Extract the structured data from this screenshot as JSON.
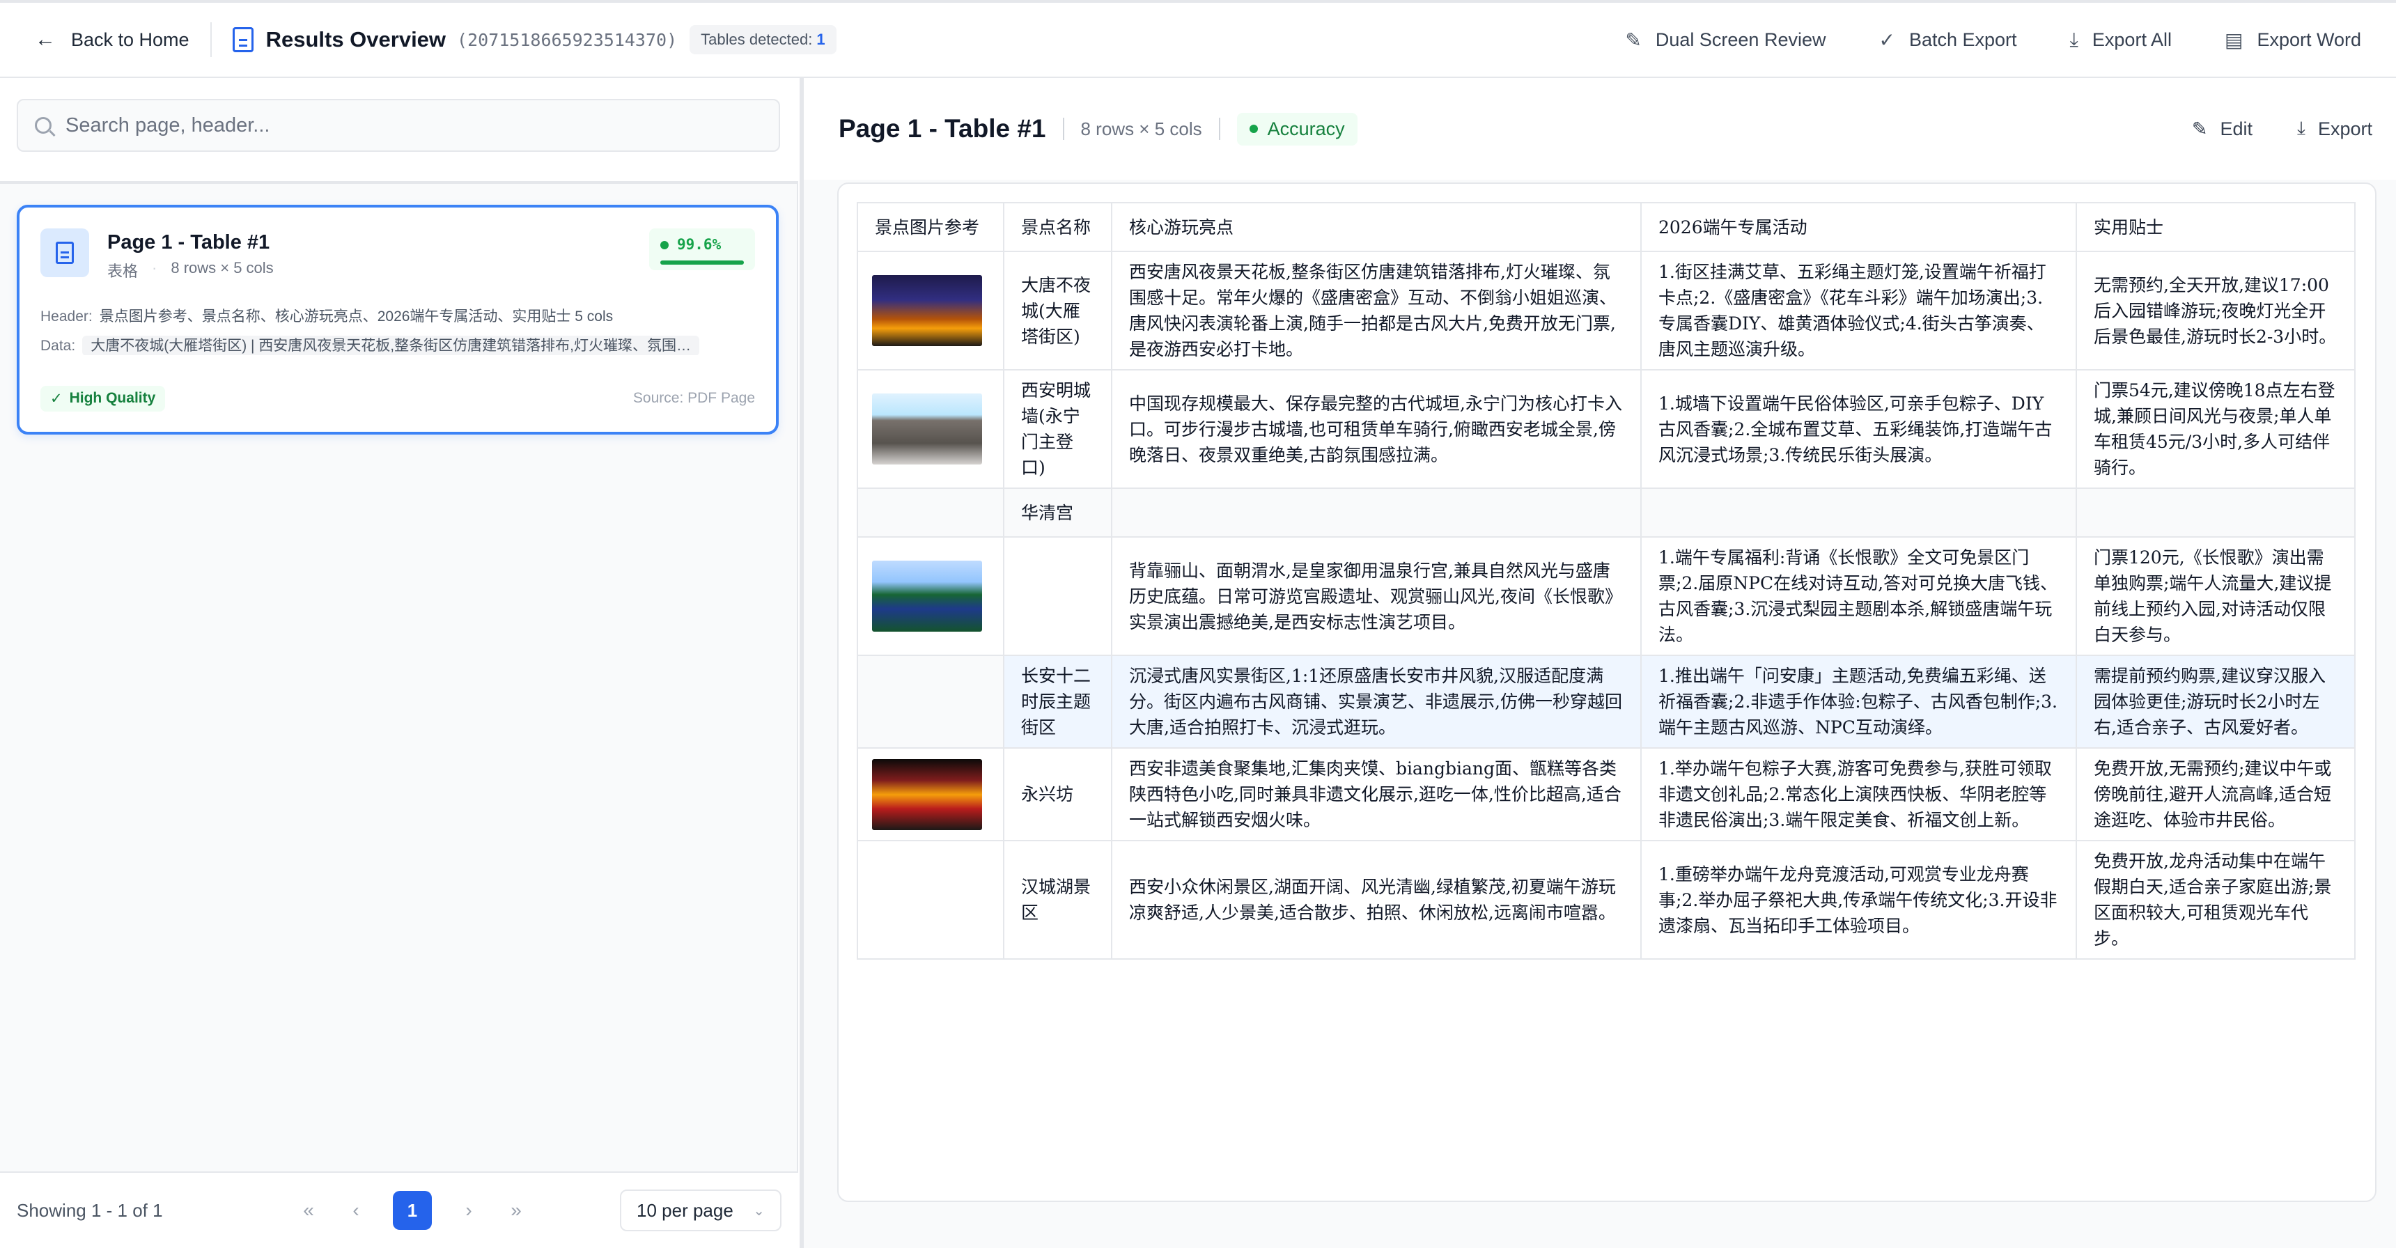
{
  "topbar": {
    "back_label": "Back to Home",
    "title": "Results Overview",
    "doc_id": "(2071518665923514370)",
    "tables_detected_label": "Tables detected:",
    "tables_detected_count": "1",
    "actions": [
      "Dual Screen Review",
      "Batch Export",
      "Export All",
      "Export Word"
    ]
  },
  "sidebar": {
    "search_placeholder": "Search page, header...",
    "card": {
      "title": "Page 1 - Table #1",
      "type": "表格",
      "dims": "8 rows × 5 cols",
      "accuracy": "99.6%",
      "accuracy_fraction": 0.996,
      "header_label": "Header:",
      "header_text": "景点图片参考、景点名称、核心游玩亮点、2026端午专属活动、实用贴士 5 cols",
      "data_label": "Data:",
      "data_text": "大唐不夜城(大雁塔街区) | 西安唐风夜景天花板,整条街区仿唐建筑错落排布,灯火璀璨、氛围…",
      "quality": "High Quality",
      "source": "Source: PDF Page"
    },
    "pagination": {
      "showing": "Showing 1 - 1 of 1",
      "current_page": "1",
      "per_page": "10 per page"
    }
  },
  "main": {
    "title": "Page 1 - Table #1",
    "dims": "8 rows × 5 cols",
    "accuracy_label": "Accuracy",
    "actions": [
      "Edit",
      "Export"
    ],
    "table": {
      "headers": [
        "景点图片参考",
        "景点名称",
        "核心游玩亮点",
        "2026端午专属活动",
        "实用贴士"
      ],
      "rows": [
        {
          "image": "night-street-photo",
          "name": "大唐不夜城(大雁塔街区)",
          "highlights": "西安唐风夜景天花板,整条街区仿唐建筑错落排布,灯火璀璨、氛围感十足。常年火爆的《盛唐密盒》互动、不倒翁小姐姐巡演、唐风快闪表演轮番上演,随手一拍都是古风大片,免费开放无门票,是夜游西安必打卡地。",
          "activity": "1.街区挂满艾草、五彩绳主题灯笼,设置端午祈福打卡点;2.《盛唐密盒》《花车斗彩》端午加场演出;3.专属香囊DIY、雄黄酒体验仪式;4.街头古筝演奏、唐风主题巡演升级。",
          "tips": "无需预约,全天开放,建议17:00后入园错峰游玩;夜晚灯光全开后景色最佳,游玩时长2-3小时。"
        },
        {
          "image": "city-wall-photo",
          "name": "西安明城墙(永宁门主登口)",
          "highlights": "中国现存规模最大、保存最完整的古代城垣,永宁门为核心打卡入口。可步行漫步古城墙,也可租赁单车骑行,俯瞰西安老城全景,傍晚落日、夜景双重绝美,古韵氛围感拉满。",
          "activity": "1.城墙下设置端午民俗体验区,可亲手包粽子、DIY古风香囊;2.全城布置艾草、五彩绳装饰,打造端午古风沉浸式场景;3.传统民乐街头展演。",
          "tips": "门票54元,建议傍晚18点左右登城,兼顾日间风光与夜景;单人单车租赁45元/3小时,多人可结伴骑行。"
        },
        {
          "image": "",
          "name": "华清宫",
          "highlights": "",
          "activity": "",
          "tips": ""
        },
        {
          "image": "palace-lake-photo",
          "name": "",
          "highlights": "背靠骊山、面朝渭水,是皇家御用温泉行宫,兼具自然风光与盛唐历史底蕴。日常可游览宫殿遗址、观赏骊山风光,夜间《长恨歌》实景演出震撼绝美,是西安标志性演艺项目。",
          "activity": "1.端午专属福利:背诵《长恨歌》全文可免景区门票;2.届原NPC在线对诗互动,答对可兑换大唐飞钱、古风香囊;3.沉浸式梨园主题剧本杀,解锁盛唐端午玩法。",
          "tips": "门票120元,《长恨歌》演出需单独购票;端午人流量大,建议提前线上预约入园,对诗活动仅限白天参与。"
        },
        {
          "image": "",
          "name": "长安十二时辰主题街区",
          "highlights": "沉浸式唐风实景街区,1:1还原盛唐长安市井风貌,汉服适配度满分。街区内遍布古风商铺、实景演艺、非遗展示,仿佛一秒穿越回大唐,适合拍照打卡、沉浸式逛玩。",
          "activity": "1.推出端午「问安康」主题活动,免费编五彩绳、送祈福香囊;2.非遗手作体验:包粽子、古风香包制作;3.端午主题古风巡游、NPC互动演绎。",
          "tips": "需提前预约购票,建议穿汉服入园体验更佳;游玩时长2小时左右,适合亲子、古风爱好者。"
        },
        {
          "image": "food-street-gate-photo",
          "name": "永兴坊",
          "highlights": "西安非遗美食聚集地,汇集肉夹馍、biangbiang面、甑糕等各类陕西特色小吃,同时兼具非遗文化展示,逛吃一体,性价比超高,适合一站式解锁西安烟火味。",
          "activity": "1.举办端午包粽子大赛,游客可免费参与,获胜可领取非遗文创礼品;2.常态化上演陕西快板、华阴老腔等非遗民俗演出;3.端午限定美食、祈福文创上新。",
          "tips": "免费开放,无需预约;建议中午或傍晚前往,避开人流高峰,适合短途逛吃、体验市井民俗。"
        },
        {
          "image": "",
          "name": "汉城湖景区",
          "highlights": "西安小众休闲景区,湖面开阔、风光清幽,绿植繁茂,初夏端午游玩凉爽舒适,人少景美,适合散步、拍照、休闲放松,远离闹市喧嚣。",
          "activity": "1.重磅举办端午龙舟竞渡活动,可观赏专业龙舟赛事;2.举办屈子祭祀大典,传承端午传统文化;3.开设非遗漆扇、瓦当拓印手工体验项目。",
          "tips": "免费开放,龙舟活动集中在端午假期白天,适合亲子家庭出游;景区面积较大,可租赁观光车代步。"
        }
      ]
    }
  }
}
